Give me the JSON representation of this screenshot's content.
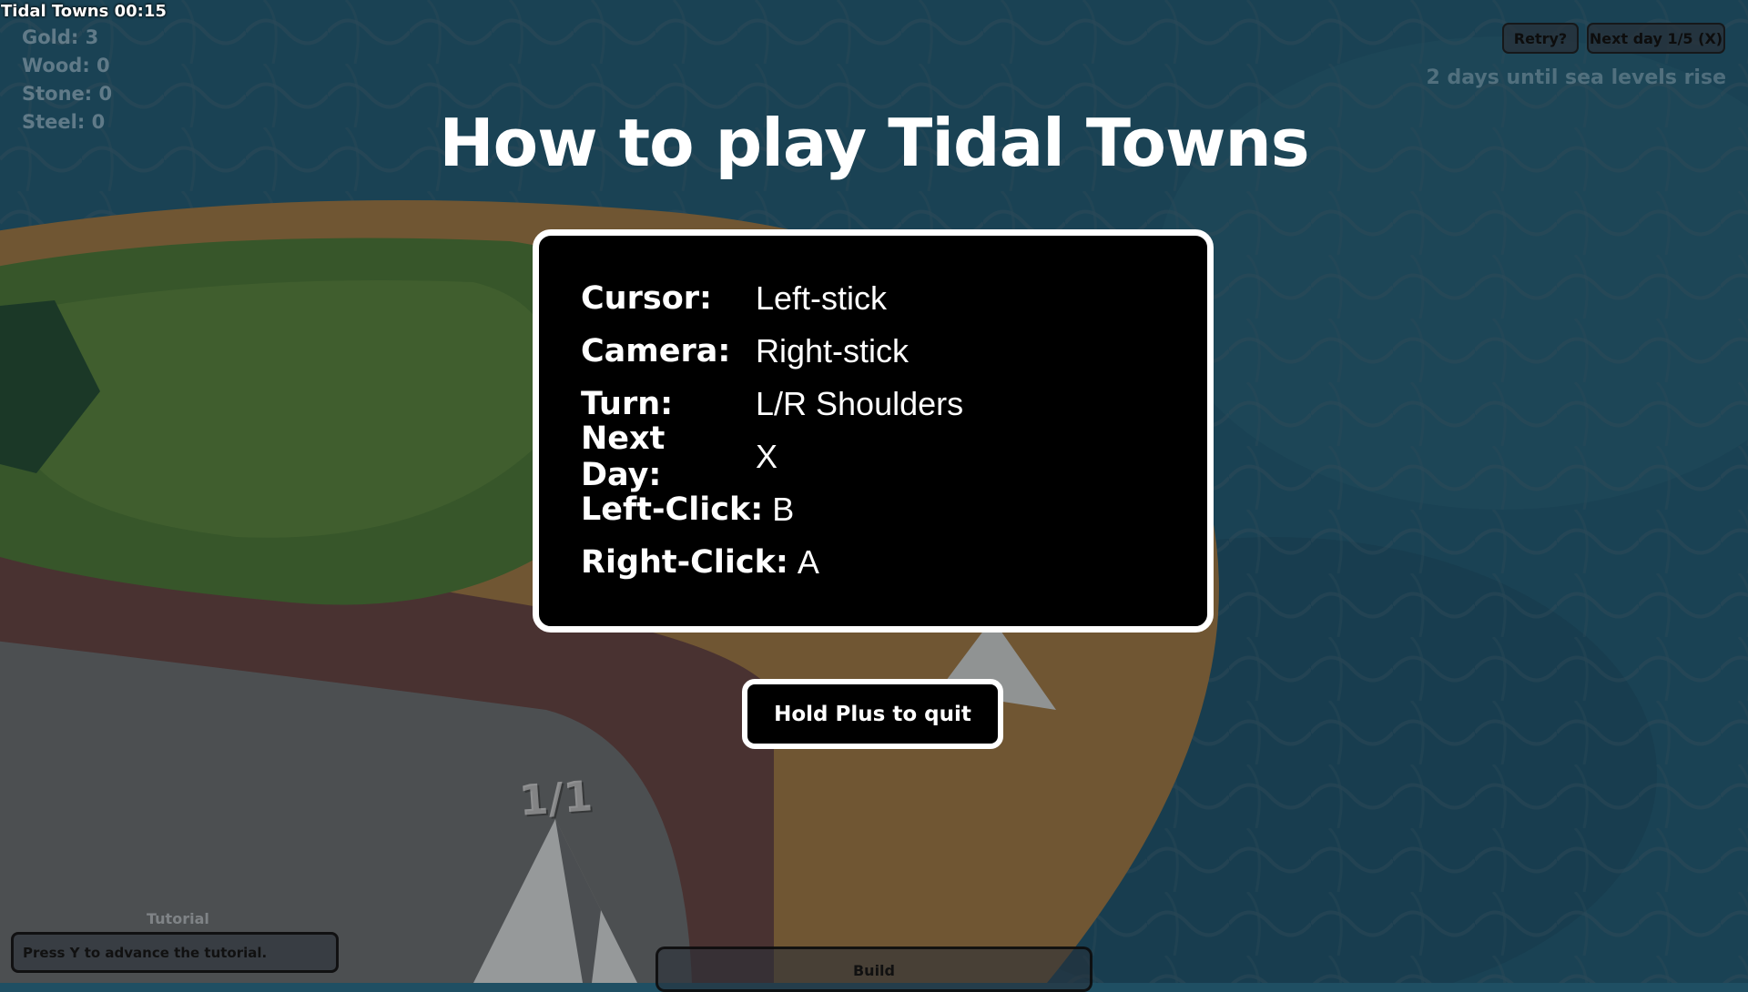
{
  "game": {
    "title": "Tidal Towns",
    "timer": "00:15"
  },
  "resources": [
    {
      "label": "Gold",
      "value": "3"
    },
    {
      "label": "Wood",
      "value": "0"
    },
    {
      "label": "Stone",
      "value": "0"
    },
    {
      "label": "Steel",
      "value": "0"
    }
  ],
  "top_buttons": {
    "retry": "Retry?",
    "next_day": "Next day 1/5 (X)"
  },
  "sea_warning": "2 days until sea levels rise",
  "help": {
    "heading": "How to play Tidal Towns",
    "controls": [
      {
        "key": "Cursor:",
        "value": "Left-stick"
      },
      {
        "key": "Camera:",
        "value": "Right-stick"
      },
      {
        "key": "Turn:",
        "value": "L/R Shoulders"
      },
      {
        "key": "Next Day:",
        "value": "X"
      },
      {
        "key": "Left-Click:",
        "value": "B"
      },
      {
        "key": "Right-Click:",
        "value": "A"
      }
    ],
    "quit_label": "Hold Plus to quit"
  },
  "world": {
    "unit_counter": "1/1"
  },
  "tutorial": {
    "label": "Tutorial",
    "message": "Press Y to advance the tutorial."
  },
  "build_panel": {
    "label": "Build"
  },
  "colors": {
    "water": "#1f5a70",
    "island_grass": "#4a7a2a",
    "sand": "#c08a3a",
    "panel_bg": "#000000",
    "panel_border": "#ffffff"
  }
}
